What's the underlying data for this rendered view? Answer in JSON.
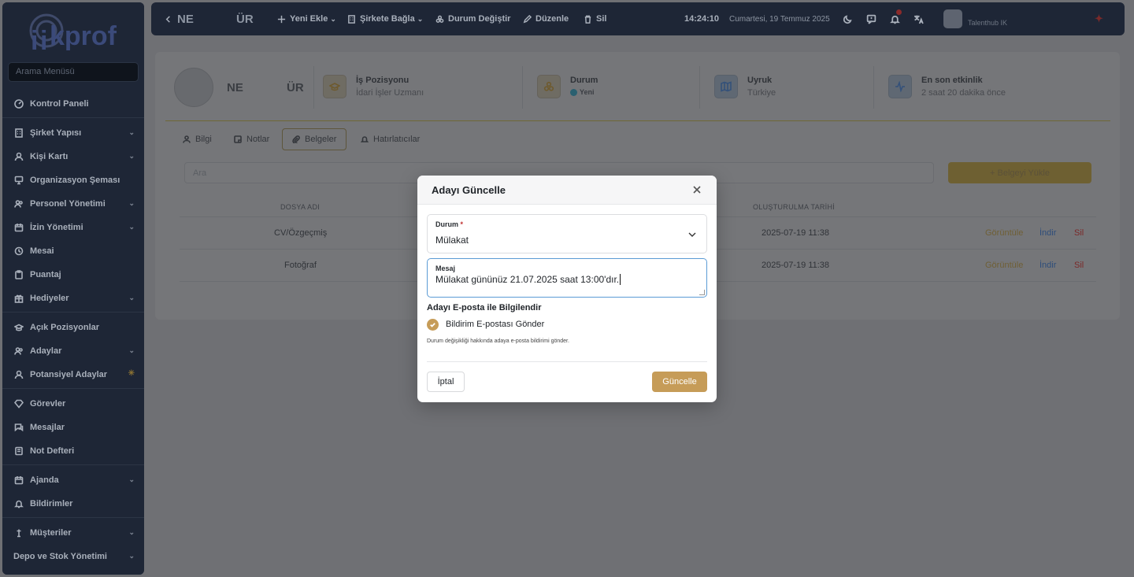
{
  "sidebar": {
    "logo_text": "ikprof",
    "search_placeholder": "Arama Menüsü",
    "items": [
      {
        "label": "Kontrol Paneli"
      },
      {
        "label": "Şirket Yapısı"
      },
      {
        "label": "Kişi Kartı"
      },
      {
        "label": "Organizasyon Şeması"
      },
      {
        "label": "Personel Yönetimi"
      },
      {
        "label": "İzin Yönetimi"
      },
      {
        "label": "Mesai"
      },
      {
        "label": "Puantaj"
      },
      {
        "label": "Hediyeler"
      },
      {
        "label": "Açık Pozisyonlar"
      },
      {
        "label": "Adaylar"
      },
      {
        "label": "Potansiyel Adaylar"
      },
      {
        "label": "Görevler"
      },
      {
        "label": "Mesajlar"
      },
      {
        "label": "Not Defteri"
      },
      {
        "label": "Ajanda"
      },
      {
        "label": "Bildirimler"
      },
      {
        "label": "Müşteriler"
      },
      {
        "label": "Depo ve Stok Yönetimi"
      }
    ]
  },
  "topbar": {
    "back_name_left": "NE",
    "back_name_right": "ÜR",
    "actions": {
      "new": "Yeni Ekle",
      "link_company": "Şirkete Bağla",
      "change_status": "Durum Değiştir",
      "edit": "Düzenle",
      "delete": "Sil"
    },
    "time": "14:24:10",
    "date": "Cumartesi, 19 Temmuz 2025",
    "user": "Talenthub IK"
  },
  "profile": {
    "name_left": "NE",
    "name_right": "ÜR",
    "position_title": "İş Pozisyonu",
    "position_value": "İdari İşler Uzmanı",
    "status_title": "Durum",
    "status_value": "Yeni",
    "nationality_title": "Uyruk",
    "nationality_value": "Türkiye",
    "activity_title": "En son etkinlik",
    "activity_value": "2 saat 20 dakika önce"
  },
  "tabs": {
    "info": "Bilgi",
    "notes": "Notlar",
    "docs": "Belgeler",
    "reminders": "Hatırlatıcılar"
  },
  "documents": {
    "search_placeholder": "Ara",
    "upload_label": "+  Belgeyi Yükle",
    "col_name": "DOSYA ADI",
    "col_created": "OLUŞTURULMA TARİHİ",
    "rows": [
      {
        "name": "CV/Özgeçmiş",
        "created": "2025-07-19 11:38",
        "view": "Görüntüle",
        "download": "İndir",
        "delete": "Sil"
      },
      {
        "name": "Fotoğraf",
        "created": "2025-07-19 11:38",
        "view": "Görüntüle",
        "download": "İndir",
        "delete": "Sil"
      }
    ]
  },
  "modal": {
    "title": "Adayı Güncelle",
    "status_label": "Durum",
    "status_required": "*",
    "status_value": "Mülakat",
    "message_label": "Mesaj",
    "message_value": "Mülakat gününüz 21.07.2025 saat 13:00'dır.",
    "notify_title": "Adayı E-posta ile Bilgilendir",
    "checkbox_label": "Bildirim E-postası Gönder",
    "checkbox_checked": true,
    "helper_text": "Durum değişikliği hakkında adaya e-posta bildirimi gönder.",
    "cancel_label": "İptal",
    "update_label": "Güncelle"
  },
  "colors": {
    "accent_gold": "#c69c58",
    "sidebar_bg": "#1e2636",
    "overlay": "#6f7074"
  }
}
